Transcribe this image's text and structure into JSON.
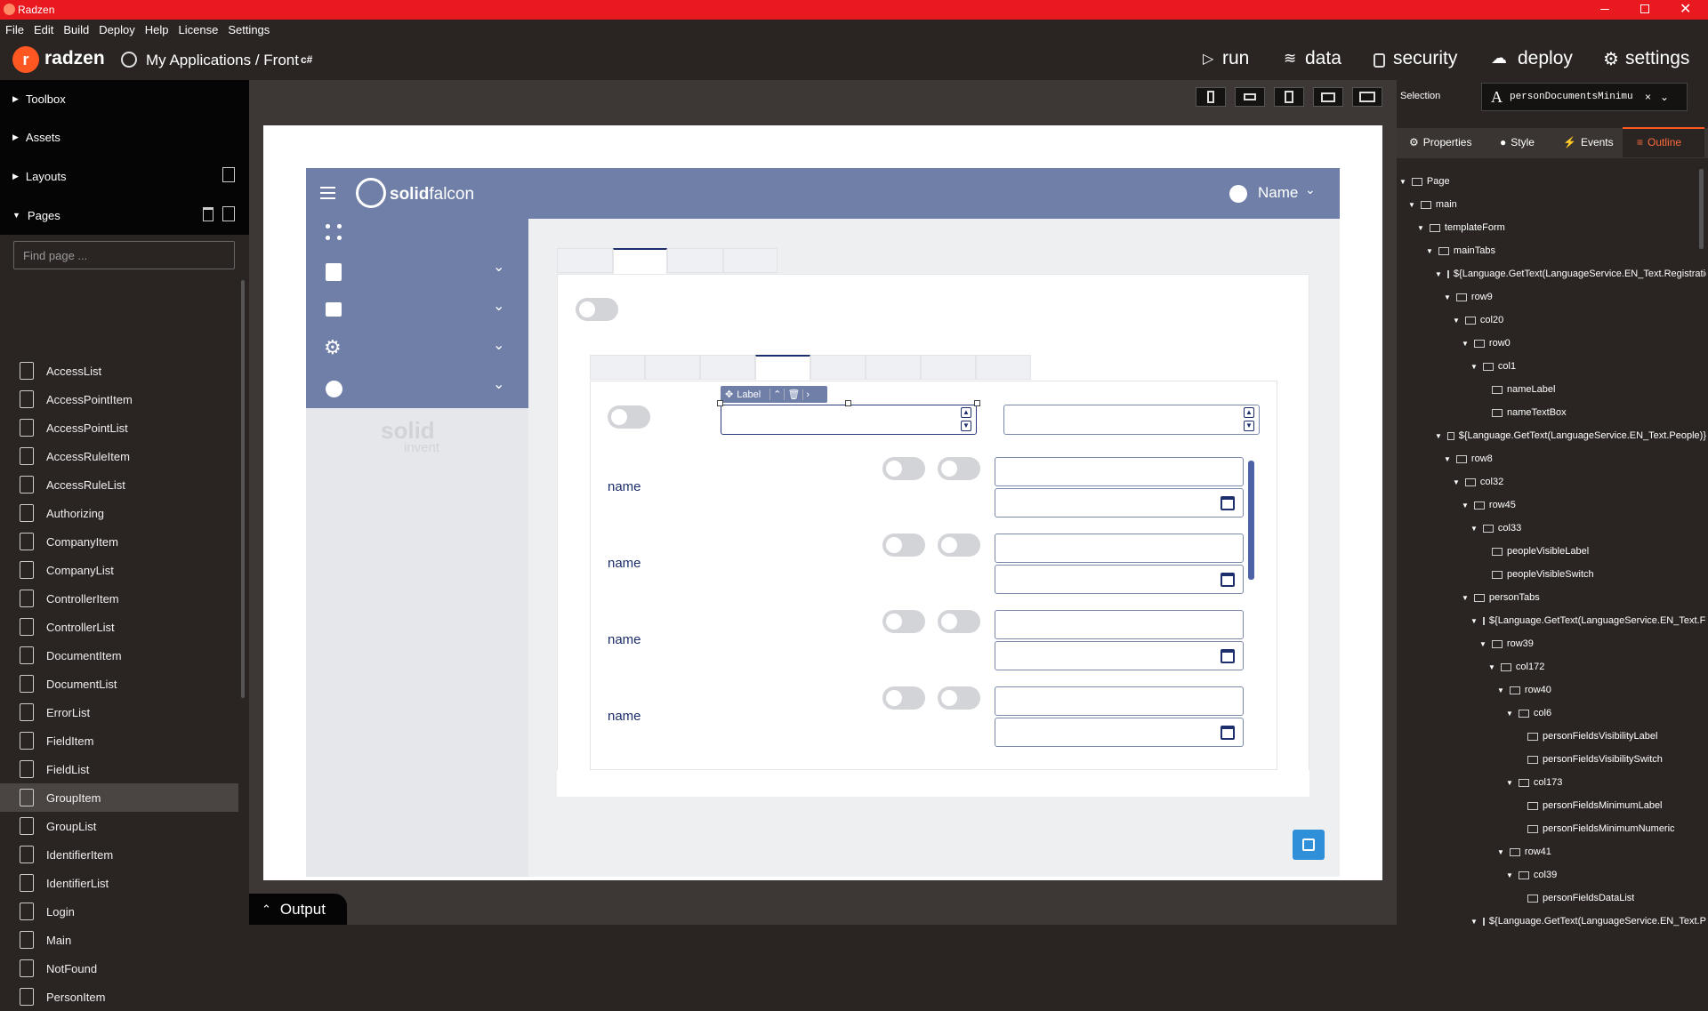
{
  "window": {
    "title": "Radzen"
  },
  "menu": {
    "items": [
      "File",
      "Edit",
      "Build",
      "Deploy",
      "Help",
      "License",
      "Settings"
    ]
  },
  "appbar": {
    "logo": "radzen",
    "breadcrumb": "My Applications / Front",
    "lang": "c#",
    "run": "run",
    "data": "data",
    "security": "security",
    "deploy": "deploy",
    "settings": "settings"
  },
  "sidebar": {
    "toolbox": "Toolbox",
    "assets": "Assets",
    "layouts": "Layouts",
    "pages": "Pages",
    "find_placeholder": "Find page ...",
    "pages_list": [
      "AccessList",
      "AccessPointItem",
      "AccessPointList",
      "AccessRuleItem",
      "AccessRuleList",
      "Authorizing",
      "CompanyItem",
      "CompanyList",
      "ControllerItem",
      "ControllerList",
      "DocumentItem",
      "DocumentList",
      "ErrorList",
      "FieldItem",
      "FieldList",
      "GroupItem",
      "GroupList",
      "IdentifierItem",
      "IdentifierList",
      "Login",
      "Main",
      "NotFound",
      "PersonItem"
    ],
    "selected": "GroupItem"
  },
  "output": {
    "label": "Output"
  },
  "design": {
    "brand": "solidfalcon",
    "brand_bold": "solid",
    "brand_light": "falcon",
    "user": "Name",
    "watermark": "solid",
    "watermark2": "invent",
    "selected_chip": "Label",
    "row_labels": [
      "name",
      "name",
      "name",
      "name"
    ]
  },
  "right": {
    "selection_label": "Selection",
    "selection_value": "personDocumentsMinimu",
    "tabs": [
      "Properties",
      "Style",
      "Events",
      "Outline"
    ],
    "active_tab": "Outline",
    "tree": [
      {
        "d": 0,
        "t": "Page"
      },
      {
        "d": 1,
        "t": "main"
      },
      {
        "d": 2,
        "t": "templateForm"
      },
      {
        "d": 3,
        "t": "mainTabs"
      },
      {
        "d": 4,
        "t": "${Language.GetText(LanguageService.EN_Text.RegistrationDa"
      },
      {
        "d": 5,
        "t": "row9"
      },
      {
        "d": 6,
        "t": "col20"
      },
      {
        "d": 7,
        "t": "row0"
      },
      {
        "d": 8,
        "t": "col1"
      },
      {
        "d": 9,
        "t": "nameLabel",
        "leaf": true
      },
      {
        "d": 9,
        "t": "nameTextBox",
        "leaf": true
      },
      {
        "d": 4,
        "t": "${Language.GetText(LanguageService.EN_Text.People)}"
      },
      {
        "d": 5,
        "t": "row8"
      },
      {
        "d": 6,
        "t": "col32"
      },
      {
        "d": 7,
        "t": "row45"
      },
      {
        "d": 8,
        "t": "col33"
      },
      {
        "d": 9,
        "t": "peopleVisibleLabel",
        "leaf": true
      },
      {
        "d": 9,
        "t": "peopleVisibleSwitch",
        "leaf": true
      },
      {
        "d": 7,
        "t": "personTabs"
      },
      {
        "d": 8,
        "t": "${Language.GetText(LanguageService.EN_Text.Fields)"
      },
      {
        "d": 9,
        "t": "row39"
      },
      {
        "d": 10,
        "t": "col172"
      },
      {
        "d": 11,
        "t": "row40"
      },
      {
        "d": 12,
        "t": "col6"
      },
      {
        "d": 13,
        "t": "personFieldsVisibilityLabel",
        "leaf": true
      },
      {
        "d": 13,
        "t": "personFieldsVisibilitySwitch",
        "leaf": true
      },
      {
        "d": 12,
        "t": "col173"
      },
      {
        "d": 13,
        "t": "personFieldsMinimumLabel",
        "leaf": true
      },
      {
        "d": 13,
        "t": "personFieldsMinimumNumeric",
        "leaf": true
      },
      {
        "d": 11,
        "t": "row41"
      },
      {
        "d": 12,
        "t": "col39"
      },
      {
        "d": 13,
        "t": "personFieldsDataList",
        "leaf": true
      },
      {
        "d": 8,
        "t": "${Language.GetText(LanguageService.EN_Text.Photo"
      }
    ]
  },
  "colors": {
    "titlebar": "#e8191f",
    "accent": "#ff5722",
    "header": "#6f7fa8",
    "save": "#2f8fd8"
  }
}
